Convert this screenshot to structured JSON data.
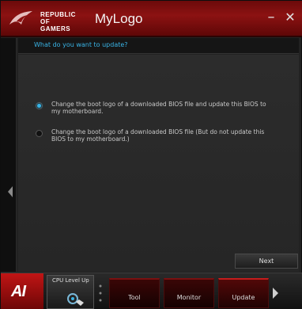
{
  "titlebar": {
    "brand_line1": "REPUBLIC OF",
    "brand_line2": "GAMERS",
    "app_title": "MyLogo",
    "minimize_glyph": "–",
    "close_glyph": "✕"
  },
  "question": "What do you want to update?",
  "options": [
    {
      "label": "Change the boot logo of a downloaded BIOS file and update this BIOS to my motherboard.",
      "selected": true
    },
    {
      "label": "Change the boot logo of a downloaded BIOS file (But do not update this BIOS to my motherboard.)",
      "selected": false
    }
  ],
  "next_button": "Next",
  "bottombar": {
    "ai_logo": "AI",
    "cpu_tile": "CPU Level Up",
    "tabs": [
      "Tool",
      "Monitor",
      "Update"
    ],
    "active_tab": "Update"
  },
  "colors": {
    "accent_blue": "#3ab4e6",
    "title_red": "#8c1212",
    "background": "#262626"
  }
}
